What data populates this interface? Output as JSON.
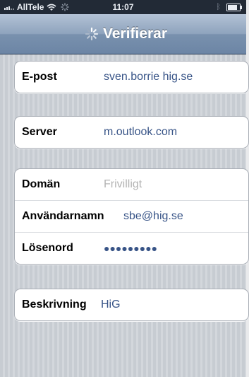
{
  "status_bar": {
    "carrier": "AllTele",
    "time": "11:07"
  },
  "nav": {
    "title": "Verifierar"
  },
  "form": {
    "email": {
      "label": "E-post",
      "value": "sven.borrie hig.se"
    },
    "server": {
      "label": "Server",
      "value": "m.outlook.com"
    },
    "domain": {
      "label": "Domän",
      "placeholder": "Frivilligt"
    },
    "username": {
      "label": "Användarnamn",
      "value": "sbe@hig.se"
    },
    "password": {
      "label": "Lösenord",
      "value": "●●●●●●●●●"
    },
    "description": {
      "label": "Beskrivning",
      "value": "HiG"
    }
  },
  "colors": {
    "accent_value_text": "#385487",
    "nav_bar": "#7b93b0",
    "status_bar": "#222a36"
  },
  "icons": [
    "signal-icon",
    "wifi-icon",
    "activity-spinner-icon",
    "bluetooth-icon",
    "battery-icon"
  ]
}
